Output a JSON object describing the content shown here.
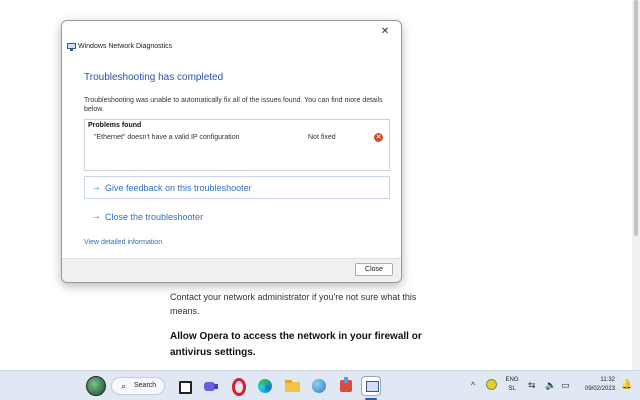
{
  "background": {
    "paragraph": "Contact your network administrator if you're not sure what this means.",
    "bold_heading": "Allow Opera to access the network in your firewall or antivirus settings."
  },
  "dialog": {
    "window_title": "Windows Network Diagnostics",
    "close_glyph": "✕",
    "heading": "Troubleshooting has completed",
    "description": "Troubleshooting was unable to automatically fix all of the issues found. You can find more details below.",
    "problems": {
      "title": "Problems found",
      "items": [
        {
          "text": "\"Ethernet\" doesn't have a valid IP configuration",
          "status": "Not fixed"
        }
      ]
    },
    "links": [
      {
        "arrow": "→",
        "label": "Give feedback on this troubleshooter"
      },
      {
        "arrow": "→",
        "label": "Close the troubleshooter"
      }
    ],
    "detail_link": "View detailed information",
    "close_button": "Close"
  },
  "taskbar": {
    "search_label": "Search",
    "search_glyph": "⌕",
    "tray": {
      "chevron": "^",
      "lang_line1": "ENG",
      "lang_line2": "SL",
      "time": "11:32",
      "date": "09/02/2023"
    }
  },
  "colors": {
    "accent": "#2f6fc0",
    "heading": "#2f4ea8",
    "error": "#d04a2c",
    "taskbar": "#dfe8f3"
  }
}
